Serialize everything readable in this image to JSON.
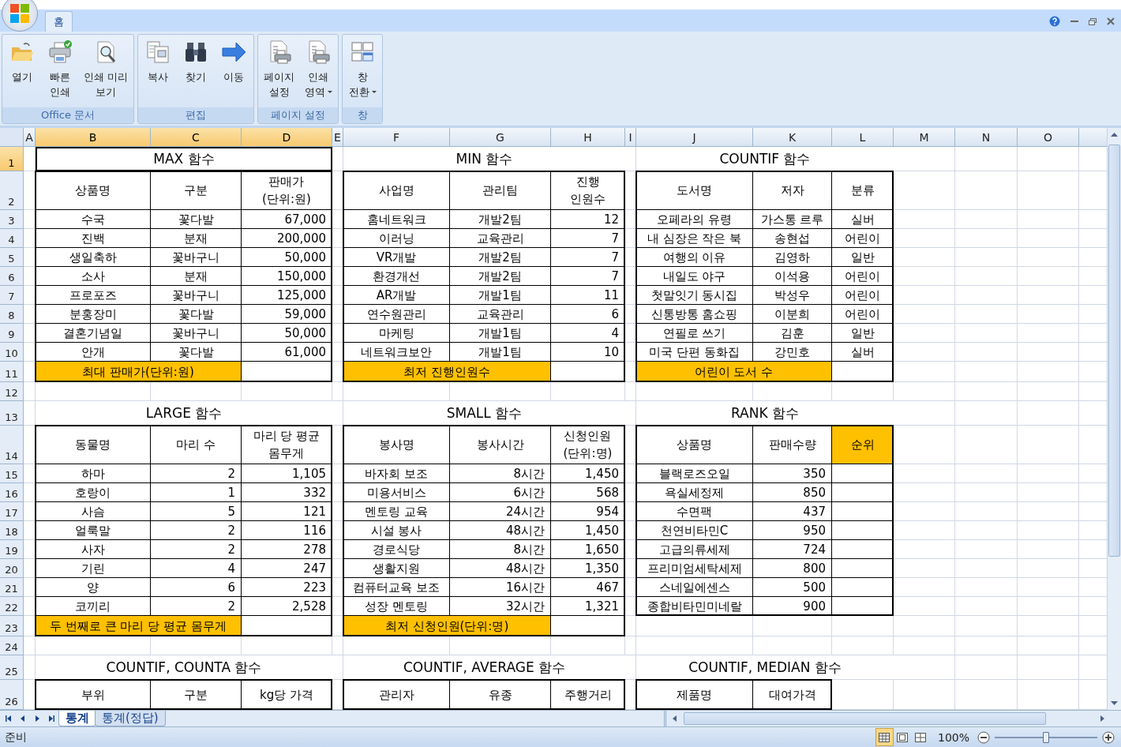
{
  "ribbon": {
    "tabs": [
      {
        "label": "홈",
        "selected": true
      }
    ],
    "groups": [
      {
        "label": "Office 문서",
        "buttons": [
          {
            "label": "열기",
            "has_menu": false
          },
          {
            "label": "빠른\n인쇄",
            "has_menu": false
          },
          {
            "label": "인쇄 미리\n보기",
            "has_menu": false
          }
        ]
      },
      {
        "label": "편집",
        "buttons": [
          {
            "label": "복사",
            "has_menu": false
          },
          {
            "label": "찾기",
            "has_menu": false
          },
          {
            "label": "이동",
            "has_menu": false
          }
        ]
      },
      {
        "label": "페이지 설정",
        "buttons": [
          {
            "label": "페이지\n설정",
            "has_menu": false
          },
          {
            "label": "인쇄\n영역",
            "has_menu": true
          }
        ]
      },
      {
        "label": "창",
        "buttons": [
          {
            "label": "창\n전환",
            "has_menu": true
          }
        ]
      }
    ]
  },
  "sheet": {
    "columns": [
      {
        "label": "A",
        "selected": false
      },
      {
        "label": "B",
        "selected": true
      },
      {
        "label": "C",
        "selected": true
      },
      {
        "label": "D",
        "selected": true
      },
      {
        "label": "E",
        "selected": false
      },
      {
        "label": "F",
        "selected": false
      },
      {
        "label": "G",
        "selected": false
      },
      {
        "label": "H",
        "selected": false
      },
      {
        "label": "I",
        "selected": false
      },
      {
        "label": "J",
        "selected": false
      },
      {
        "label": "K",
        "selected": false
      },
      {
        "label": "L",
        "selected": false
      },
      {
        "label": "M",
        "selected": false
      },
      {
        "label": "N",
        "selected": false
      },
      {
        "label": "O",
        "selected": false
      }
    ],
    "rows": [
      {
        "label": "1",
        "selected": true
      },
      {
        "label": "2",
        "selected": false
      },
      {
        "label": "3",
        "selected": false
      },
      {
        "label": "4",
        "selected": false
      },
      {
        "label": "5",
        "selected": false
      },
      {
        "label": "6",
        "selected": false
      },
      {
        "label": "7",
        "selected": false
      },
      {
        "label": "8",
        "selected": false
      },
      {
        "label": "9",
        "selected": false
      },
      {
        "label": "10",
        "selected": false
      },
      {
        "label": "11",
        "selected": false
      },
      {
        "label": "12",
        "selected": false
      },
      {
        "label": "13",
        "selected": false
      },
      {
        "label": "14",
        "selected": false
      },
      {
        "label": "15",
        "selected": false
      },
      {
        "label": "16",
        "selected": false
      },
      {
        "label": "17",
        "selected": false
      },
      {
        "label": "18",
        "selected": false
      },
      {
        "label": "19",
        "selected": false
      },
      {
        "label": "20",
        "selected": false
      },
      {
        "label": "21",
        "selected": false
      },
      {
        "label": "22",
        "selected": false
      },
      {
        "label": "23",
        "selected": false
      },
      {
        "label": "24",
        "selected": false
      },
      {
        "label": "25",
        "selected": false
      },
      {
        "label": "26",
        "selected": false
      }
    ],
    "tables": [
      {
        "title": "MAX 함수",
        "selected": true,
        "columns": [
          {
            "label": "상품명",
            "kind": "text",
            "highlighted": false
          },
          {
            "label": "구분",
            "kind": "text",
            "highlighted": false
          },
          {
            "label": "판매가\n(단위:원)",
            "kind": "number",
            "highlighted": false
          }
        ],
        "rows": [
          [
            "수국",
            "꽃다발",
            "67,000"
          ],
          [
            "진백",
            "분재",
            "200,000"
          ],
          [
            "생일축하",
            "꽃바구니",
            "50,000"
          ],
          [
            "소사",
            "분재",
            "150,000"
          ],
          [
            "프로포즈",
            "꽃바구니",
            "125,000"
          ],
          [
            "분홍장미",
            "꽃다발",
            "59,000"
          ],
          [
            "결혼기념일",
            "꽃바구니",
            "50,000"
          ],
          [
            "안개",
            "꽃다발",
            "61,000"
          ]
        ],
        "footer": "최대 판매가(단위:원)"
      },
      {
        "title": "MIN 함수",
        "selected": false,
        "columns": [
          {
            "label": "사업명",
            "kind": "text",
            "highlighted": false
          },
          {
            "label": "관리팀",
            "kind": "text",
            "highlighted": false
          },
          {
            "label": "진행\n인원수",
            "kind": "number",
            "highlighted": false
          }
        ],
        "rows": [
          [
            "홈네트워크",
            "개발2팀",
            "12"
          ],
          [
            "이러닝",
            "교육관리",
            "7"
          ],
          [
            "VR개발",
            "개발2팀",
            "7"
          ],
          [
            "환경개선",
            "개발2팀",
            "7"
          ],
          [
            "AR개발",
            "개발1팀",
            "11"
          ],
          [
            "연수원관리",
            "교육관리",
            "6"
          ],
          [
            "마케팅",
            "개발1팀",
            "4"
          ],
          [
            "네트워크보안",
            "개발1팀",
            "10"
          ]
        ],
        "footer": "최저 진행인원수"
      },
      {
        "title": "COUNTIF 함수",
        "selected": false,
        "columns": [
          {
            "label": "도서명",
            "kind": "text",
            "highlighted": false
          },
          {
            "label": "저자",
            "kind": "text",
            "highlighted": false
          },
          {
            "label": "분류",
            "kind": "text",
            "highlighted": false
          }
        ],
        "rows": [
          [
            "오페라의 유령",
            "가스통 르루",
            "실버"
          ],
          [
            "내 심장은 작은 북",
            "송현섭",
            "어린이"
          ],
          [
            "여행의 이유",
            "김영하",
            "일반"
          ],
          [
            "내일도 야구",
            "이석용",
            "어린이"
          ],
          [
            "첫말잇기 동시집",
            "박성우",
            "어린이"
          ],
          [
            "신통방통 홈쇼핑",
            "이분희",
            "어린이"
          ],
          [
            "연필로 쓰기",
            "김훈",
            "일반"
          ],
          [
            "미국 단편 동화집",
            "강민호",
            "실버"
          ]
        ],
        "footer": "어린이 도서 수"
      },
      {
        "title": "LARGE 함수",
        "selected": false,
        "columns": [
          {
            "label": "동물명",
            "kind": "text",
            "highlighted": false
          },
          {
            "label": "마리 수",
            "kind": "number",
            "highlighted": false
          },
          {
            "label": "마리 당 평균\n몸무게",
            "kind": "number",
            "highlighted": false
          }
        ],
        "rows": [
          [
            "하마",
            "2",
            "1,105"
          ],
          [
            "호랑이",
            "1",
            "332"
          ],
          [
            "사슴",
            "5",
            "121"
          ],
          [
            "얼룩말",
            "2",
            "116"
          ],
          [
            "사자",
            "2",
            "278"
          ],
          [
            "기린",
            "4",
            "247"
          ],
          [
            "양",
            "6",
            "223"
          ],
          [
            "코끼리",
            "2",
            "2,528"
          ]
        ],
        "footer": "두 번째로 큰 마리 당 평균 몸무게"
      },
      {
        "title": "SMALL 함수",
        "selected": false,
        "columns": [
          {
            "label": "봉사명",
            "kind": "text",
            "highlighted": false
          },
          {
            "label": "봉사시간",
            "kind": "number",
            "highlighted": false
          },
          {
            "label": "신청인원\n(단위:명)",
            "kind": "number",
            "highlighted": false
          }
        ],
        "rows": [
          [
            "바자회 보조",
            "8시간",
            "1,450"
          ],
          [
            "미용서비스",
            "6시간",
            "568"
          ],
          [
            "멘토링 교육",
            "24시간",
            "954"
          ],
          [
            "시설 봉사",
            "48시간",
            "1,450"
          ],
          [
            "경로식당",
            "8시간",
            "1,650"
          ],
          [
            "생활지원",
            "48시간",
            "1,350"
          ],
          [
            "컴퓨터교육 보조",
            "16시간",
            "467"
          ],
          [
            "성장 멘토링",
            "32시간",
            "1,321"
          ]
        ],
        "footer": "최저 신청인원(단위:명)"
      },
      {
        "title": "RANK 함수",
        "selected": false,
        "columns": [
          {
            "label": "상품명",
            "kind": "text",
            "highlighted": false
          },
          {
            "label": "판매수량",
            "kind": "number",
            "highlighted": false
          },
          {
            "label": "순위",
            "kind": "text",
            "highlighted": true
          }
        ],
        "rows": [
          [
            "블랙로즈오일",
            "350"
          ],
          [
            "욕실세정제",
            "850"
          ],
          [
            "수면팩",
            "437"
          ],
          [
            "천연비타민C",
            "950"
          ],
          [
            "고급의류세제",
            "724"
          ],
          [
            "프리미엄세탁세제",
            "800"
          ],
          [
            "스네일에센스",
            "500"
          ],
          [
            "종합비타민미네랄",
            "900"
          ]
        ]
      },
      {
        "title": "COUNTIF, COUNTA 함수",
        "selected": false,
        "columns": [
          {
            "label": "부위",
            "highlighted": false
          },
          {
            "label": "구분",
            "highlighted": false
          },
          {
            "label": "kg당 가격",
            "highlighted": false
          }
        ]
      },
      {
        "title": "COUNTIF, AVERAGE 함수",
        "selected": false,
        "columns": [
          {
            "label": "관리자",
            "highlighted": false
          },
          {
            "label": "유종",
            "highlighted": false
          },
          {
            "label": "주행거리",
            "highlighted": false
          }
        ]
      },
      {
        "title": "COUNTIF, MEDIAN 함수",
        "selected": false,
        "columns": [
          {
            "label": "제품명",
            "highlighted": false
          },
          {
            "label": "대여가격",
            "highlighted": false
          }
        ]
      }
    ]
  },
  "sheet_tabs": [
    {
      "label": "통계",
      "selected": true
    },
    {
      "label": "통계(정답)",
      "selected": false
    }
  ],
  "status_bar": {
    "status": "준비",
    "views": [
      {
        "selected": true
      },
      {
        "selected": false
      },
      {
        "selected": false
      }
    ],
    "zoom": "100%",
    "zoom_level": {
      "level": 0.5
    }
  }
}
